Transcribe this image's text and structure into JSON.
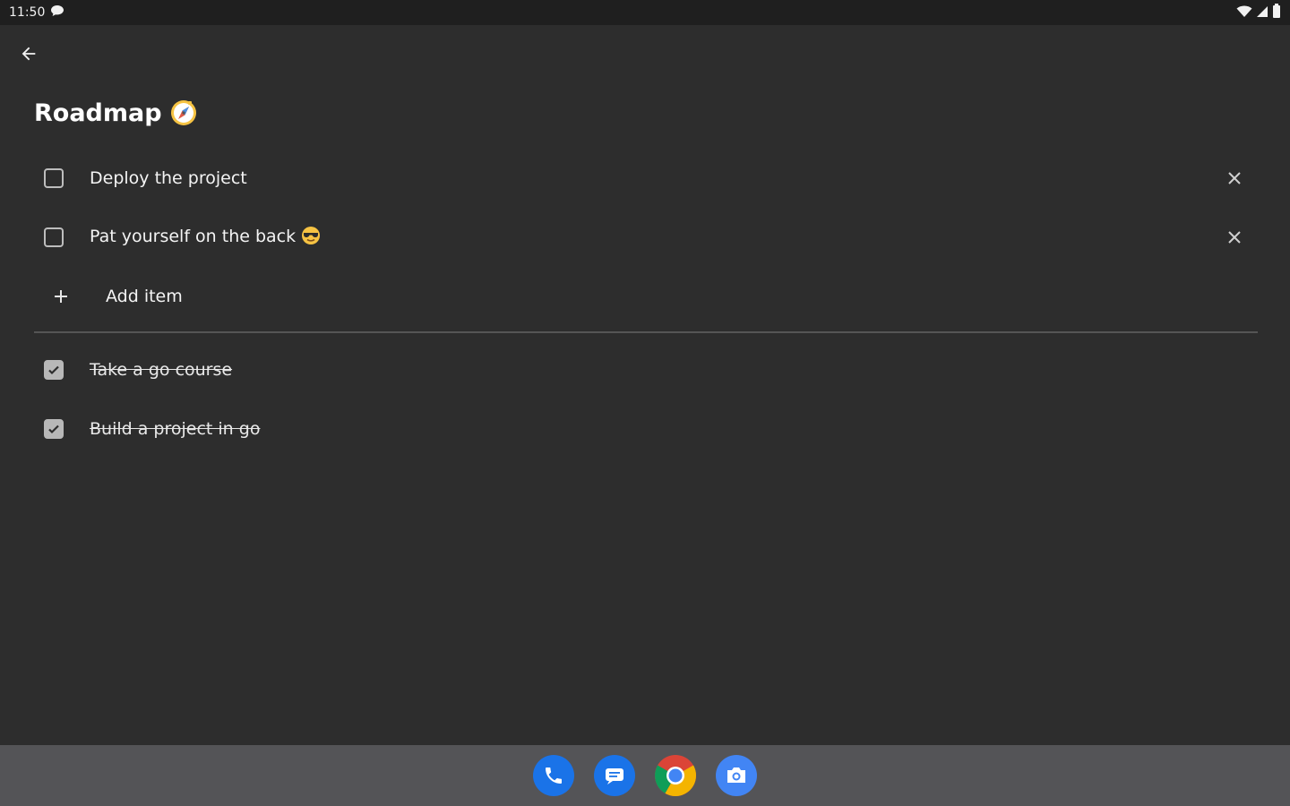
{
  "status_bar": {
    "time": "11:50",
    "icons": [
      "chat-bubble-icon",
      "wifi-icon",
      "signal-icon",
      "battery-icon"
    ]
  },
  "header": {
    "back_icon": "arrow-back-icon"
  },
  "page": {
    "title": "Roadmap",
    "title_emoji": "compass-icon"
  },
  "todos": {
    "open": [
      {
        "label": "Deploy the project",
        "checked": false
      },
      {
        "label": "Pat yourself on the back",
        "checked": false,
        "emoji": "sunglasses-face-icon"
      }
    ],
    "add_label": "Add item",
    "done": [
      {
        "label": "Take a go course",
        "checked": true
      },
      {
        "label": "Build a project in go",
        "checked": true
      }
    ]
  },
  "dock": {
    "apps": [
      "phone-icon",
      "messages-icon",
      "chrome-icon",
      "camera-icon"
    ]
  },
  "colors": {
    "background": "#2d2d2d",
    "status_bar": "#1f1f1f",
    "dock": "#545457",
    "divider": "#555555",
    "checkbox": "#bdbdbd",
    "accent_blue": "#1a73e8"
  }
}
